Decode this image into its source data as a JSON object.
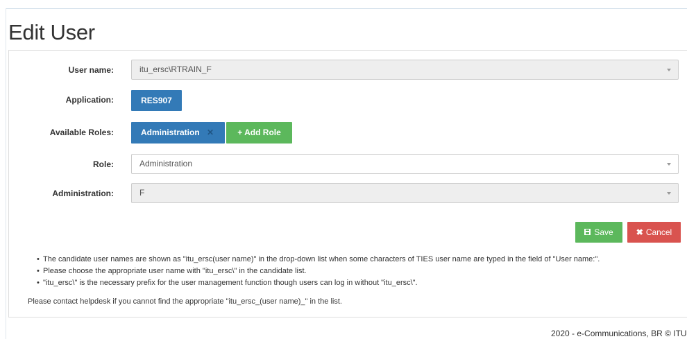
{
  "page": {
    "title": "Edit User"
  },
  "form": {
    "user_name": {
      "label": "User name:",
      "value": "itu_ersc\\RTRAIN_F"
    },
    "application": {
      "label": "Application:",
      "value": "RES907"
    },
    "available_roles": {
      "label": "Available Roles:",
      "role_tag": "Administration",
      "remove_glyph": "✕",
      "add_role_label": "+ Add Role"
    },
    "role": {
      "label": "Role:",
      "value": "Administration"
    },
    "administration": {
      "label": "Administration:",
      "value": "F"
    }
  },
  "actions": {
    "save_label": "Save",
    "cancel_label": "Cancel"
  },
  "notes": [
    "The candidate user names are shown as \"itu_ersc(user name)\" in the drop-down list when some characters of TIES user name are typed in the field of \"User name:\".",
    "Please choose the appropriate user name with \"itu_ersc\\\" in the candidate list.",
    "\"itu_ersc\\\" is the necessary prefix for the user management function though users can log in without \"itu_ersc\\\"."
  ],
  "contact": "Please contact helpdesk if you cannot find the appropriate \"itu_ersc_(user name)_\" in the list.",
  "footer": "2020 - e-Communications, BR © ITU",
  "colors": {
    "primary": "#337ab7",
    "success": "#5cb85c",
    "danger": "#d9534f"
  }
}
